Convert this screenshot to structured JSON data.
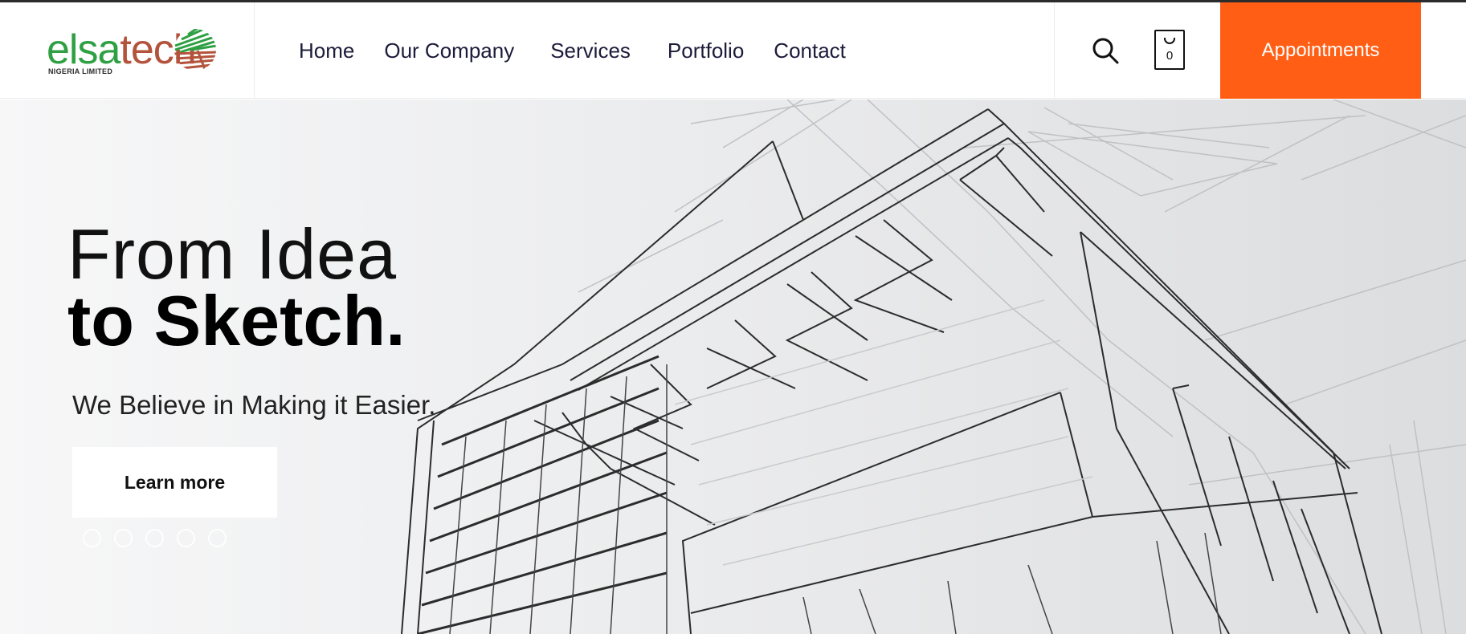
{
  "brand": {
    "logo_text_green": "elsa",
    "logo_text_red": "tech",
    "logo_subtitle": "NIGERIA LIMITED",
    "colors": {
      "green": "#2ea043",
      "red": "#b4533b",
      "accent": "#ff5e14"
    }
  },
  "nav": {
    "items": [
      {
        "label": "Home"
      },
      {
        "label": "Our Company"
      },
      {
        "label": "Services"
      },
      {
        "label": "Portfolio"
      },
      {
        "label": "Contact"
      }
    ]
  },
  "tools": {
    "search_icon": "search-icon",
    "cart_icon": "shopping-bag-icon",
    "cart_count": "0"
  },
  "cta": {
    "appointments_label": "Appointments"
  },
  "hero": {
    "headline_light": "From Idea",
    "headline_bold": "to Sketch.",
    "subheading": "We Believe in Making it Easier.",
    "button_label": "Learn more",
    "slide_count": 5,
    "background": "architectural line sketch of a building"
  }
}
